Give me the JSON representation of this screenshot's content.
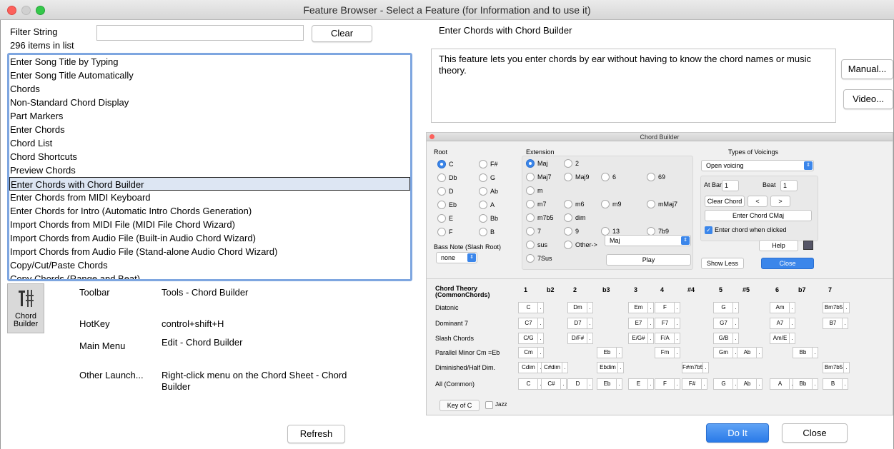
{
  "window": {
    "title": "Feature Browser - Select a Feature (for Information and to use it)"
  },
  "filter": {
    "label": "Filter String",
    "value": "",
    "clear_label": "Clear",
    "count_text": "296 items in list"
  },
  "feature_list": [
    "Enter Song Title by Typing",
    "Enter Song Title Automatically",
    "Chords",
    "Non-Standard Chord Display",
    "Part Markers",
    "Enter Chords",
    "Chord List",
    "Chord Shortcuts",
    "Preview Chords",
    "Enter Chords with Chord Builder",
    "Enter Chords from MIDI Keyboard",
    "Enter Chords for Intro (Automatic Intro Chords Generation)",
    "Import Chords from MIDI File (MIDI File Chord Wizard)",
    "Import Chords from Audio File (Built-in Audio Chord Wizard)",
    "Import Chords from Audio File (Stand-alone Audio Chord Wizard)",
    "Copy/Cut/Paste Chords",
    "Copy Chords (Range and Beat)"
  ],
  "selected_index": 9,
  "details": {
    "icon_label_1": "Chord",
    "icon_label_2": "Builder",
    "toolbar_key": "Toolbar",
    "toolbar_val": "Tools - Chord Builder",
    "hotkey_key": "HotKey",
    "hotkey_val": "control+shift+H",
    "menu_key": "Main Menu",
    "menu_val": "Edit - Chord Builder",
    "other_key": "Other Launch...",
    "other_val": "Right-click menu on the Chord Sheet - Chord Builder"
  },
  "feature": {
    "title": "Enter Chords with Chord Builder",
    "description": "This feature lets you enter chords by ear without having to know the chord names or music theory.",
    "manual_label": "Manual...",
    "video_label": "Video..."
  },
  "footer": {
    "refresh_label": "Refresh",
    "doit_label": "Do It",
    "close_label": "Close"
  },
  "chord_builder": {
    "title": "Chord Builder",
    "root_label": "Root",
    "roots": [
      "C",
      "F#",
      "Db",
      "G",
      "D",
      "Ab",
      "Eb",
      "A",
      "E",
      "Bb",
      "F",
      "B"
    ],
    "extension_label": "Extension",
    "extensions": [
      "Maj",
      "2",
      "Maj7",
      "Maj9",
      "6",
      "69",
      "m",
      "m7",
      "m6",
      "m9",
      "mMaj7",
      "m7b5",
      "dim",
      "7",
      "9",
      "13",
      "7b9",
      "sus",
      "Other->",
      "7Sus"
    ],
    "other_value": "Maj",
    "bass_label": "Bass Note (Slash Root)",
    "bass_value": "none",
    "play_label": "Play",
    "voicings_label": "Types of Voicings",
    "voicing_value": "Open voicing",
    "at_bar_label": "At Bar",
    "at_bar_value": "1",
    "beat_label": "Beat",
    "beat_value": "1",
    "clear_chord": "Clear Chord",
    "prev": "<",
    "next": ">",
    "enter_chord": "Enter Chord CMaj",
    "enter_when_clicked": "Enter chord when clicked",
    "help": "Help",
    "show_less": "Show Less",
    "close": "Close",
    "theory_label": "Chord Theory (CommonChords)",
    "degrees": [
      "1",
      "b2",
      "2",
      "b3",
      "3",
      "4",
      "#4",
      "5",
      "#5",
      "6",
      "b7",
      "7"
    ],
    "rows": [
      {
        "label": "Diatonic",
        "cells": [
          "C",
          "",
          "Dm",
          "",
          "Em",
          "F",
          "",
          "G",
          "",
          "Am",
          "",
          "Bm7b5"
        ]
      },
      {
        "label": "Dominant 7",
        "cells": [
          "C7",
          "",
          "D7",
          "",
          "E7",
          "F7",
          "",
          "G7",
          "",
          "A7",
          "",
          "B7"
        ]
      },
      {
        "label": "Slash Chords",
        "cells": [
          "C/G",
          "",
          "D/F#",
          "",
          "E/G#",
          "F/A",
          "",
          "G/B",
          "",
          "Am/E",
          "",
          ""
        ]
      },
      {
        "label": "Parallel Minor Cm =Eb",
        "cells": [
          "Cm",
          "",
          "",
          "Eb",
          "",
          "Fm",
          "",
          "Gm",
          "Ab",
          "",
          "Bb",
          ""
        ]
      },
      {
        "label": "Diminished/Half Dim.",
        "cells": [
          "Cdim",
          "C#dim",
          "",
          "Ebdim",
          "",
          "",
          "F#m7b5",
          "",
          "",
          "",
          "",
          "Bm7b5"
        ]
      },
      {
        "label": "All (Common)",
        "cells": [
          "C",
          "C#",
          "D",
          "Eb",
          "E",
          "F",
          "F#",
          "G",
          "Ab",
          "A",
          "Bb",
          "B"
        ]
      }
    ],
    "key_label": "Key of C",
    "jazz_label": "Jazz"
  }
}
